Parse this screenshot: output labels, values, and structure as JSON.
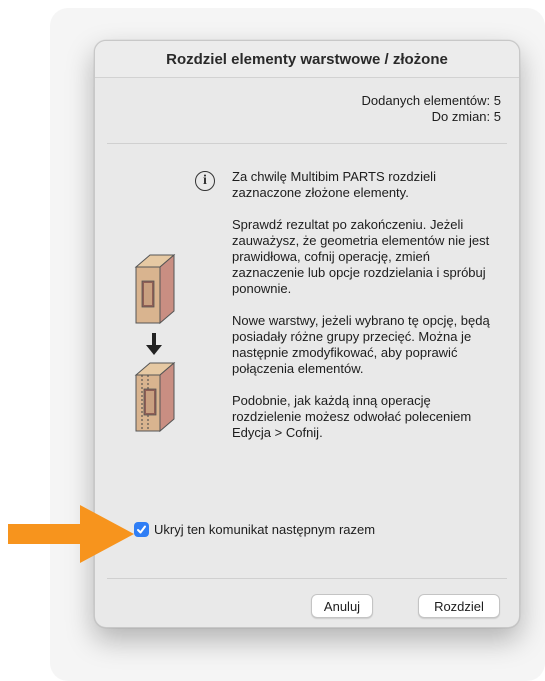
{
  "dialog": {
    "title": "Rozdziel elementy warstwowe / złożone",
    "counts": {
      "added": "Dodanych elementów: 5",
      "to_change": "Do zmian: 5"
    },
    "messages": [
      "Za chwilę Multibim PARTS rozdzieli zaznaczone złożone elementy.",
      "Sprawdź rezultat po zakończeniu. Jeżeli zauważysz, że geometria elementów nie jest prawidłowa, cofnij operację, zmień zaznaczenie lub opcje rozdzielania i spróbuj ponownie.",
      "Nowe warstwy, jeżeli wybrano tę opcję, będą posiadały różne grupy przecięć. Można je następnie zmodyfikować, aby poprawić połączenia elementów.",
      "Podobnie, jak każdą inną operację rozdzielenie możesz odwołać poleceniem Edycja > Cofnij."
    ],
    "checkbox": {
      "label": "Ukryj ten komunikat następnym razem",
      "checked": true
    },
    "buttons": {
      "cancel": "Anuluj",
      "confirm": "Rozdziel"
    }
  },
  "colors": {
    "accent": "#2f7ef5",
    "annotation_arrow": "#f7941d"
  },
  "icons": {
    "info": "info-circle-icon",
    "arrow": "arrow-down-icon",
    "checkmark": "checkmark-icon"
  }
}
